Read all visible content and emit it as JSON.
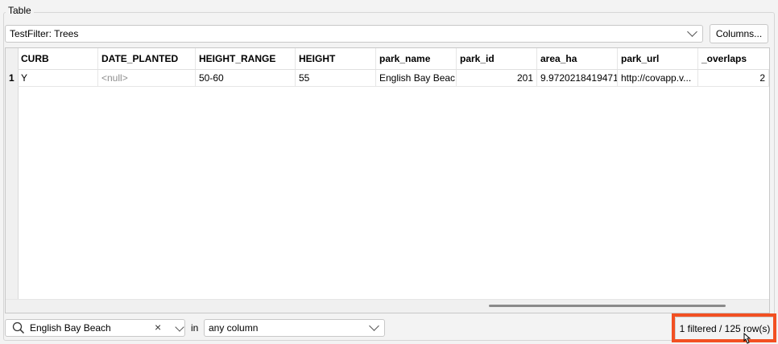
{
  "group": {
    "title": "Table"
  },
  "filter_combo": {
    "value": "TestFilter: Trees"
  },
  "columns_button": {
    "label": "Columns..."
  },
  "table": {
    "columns": [
      "CURB",
      "DATE_PLANTED",
      "HEIGHT_RANGE",
      "HEIGHT",
      "park_name",
      "park_id",
      "area_ha",
      "park_url",
      "_overlaps"
    ],
    "rows": [
      {
        "num": "1",
        "cells": [
          "Y",
          "<null>",
          "50-60",
          "55",
          "English Bay Beac...",
          "201",
          "9.97202184194711",
          "http://covapp.v...",
          "2"
        ]
      }
    ]
  },
  "search": {
    "value": "English Bay Beach",
    "in_label": "in",
    "scope_value": "any column"
  },
  "status": {
    "text": "1 filtered / 125 row(s)"
  },
  "colors": {
    "highlight": "#f25022",
    "null_text": "#8f8f8f"
  }
}
